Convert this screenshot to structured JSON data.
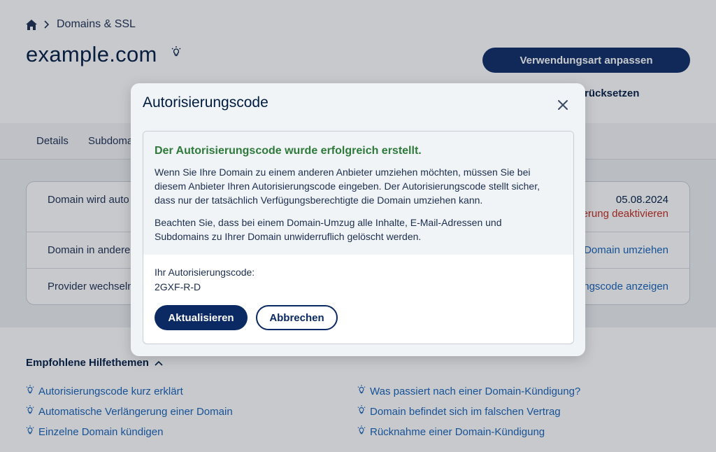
{
  "breadcrumb": {
    "section": "Domains & SSL"
  },
  "header": {
    "domain": "example.com",
    "primary_button": "Verwendungsart anpassen",
    "reset_link": "rücksetzen"
  },
  "tabs": [
    {
      "label": "Details"
    },
    {
      "label": "Subdoma"
    }
  ],
  "card": {
    "rows": [
      {
        "label": "Domain wird auto",
        "date": "05.08.2024",
        "action": "erung deaktivieren"
      },
      {
        "label": "Domain in andere",
        "action": "Domain umziehen"
      },
      {
        "label": "Provider wechseln",
        "action": "ngscode anzeigen"
      }
    ]
  },
  "help": {
    "title": "Empfohlene Hilfethemen",
    "left": [
      "Autorisierungscode kurz erklärt",
      "Automatische Verlängerung einer Domain",
      "Einzelne Domain kündigen"
    ],
    "right": [
      "Was passiert nach einer Domain-Kündigung?",
      "Domain befindet sich im falschen Vertrag",
      "Rücknahme einer Domain-Kündigung"
    ]
  },
  "modal": {
    "title": "Autorisierungscode",
    "success_title": "Der Autorisierungscode wurde erfolgreich erstellt.",
    "paragraph1_line1": "Wenn Sie Ihre Domain zu einem anderen Anbieter umziehen möchten, müssen Sie bei",
    "paragraph1_line2": "diesem Anbieter Ihren Autorisierungscode eingeben. Der Autorisierungscode stellt sicher,",
    "paragraph1_line3": "dass nur der tatsächlich Verfügungsberechtigte die Domain umziehen kann.",
    "paragraph2_line1": "Beachten Sie, dass bei einem Domain-Umzug alle Inhalte, E-Mail-Adressen und",
    "paragraph2_line2": "Subdomains zu Ihrer Domain unwiderruflich gelöscht werden.",
    "code_label": "Ihr Autorisierungscode:",
    "code_value": "2GXF-R-D",
    "update_button": "Aktualisieren",
    "cancel_button": "Abbrechen"
  },
  "colors": {
    "primary": "#0b2a63",
    "success": "#2d7a3a",
    "link": "#1461b7",
    "danger": "#c4281c"
  }
}
